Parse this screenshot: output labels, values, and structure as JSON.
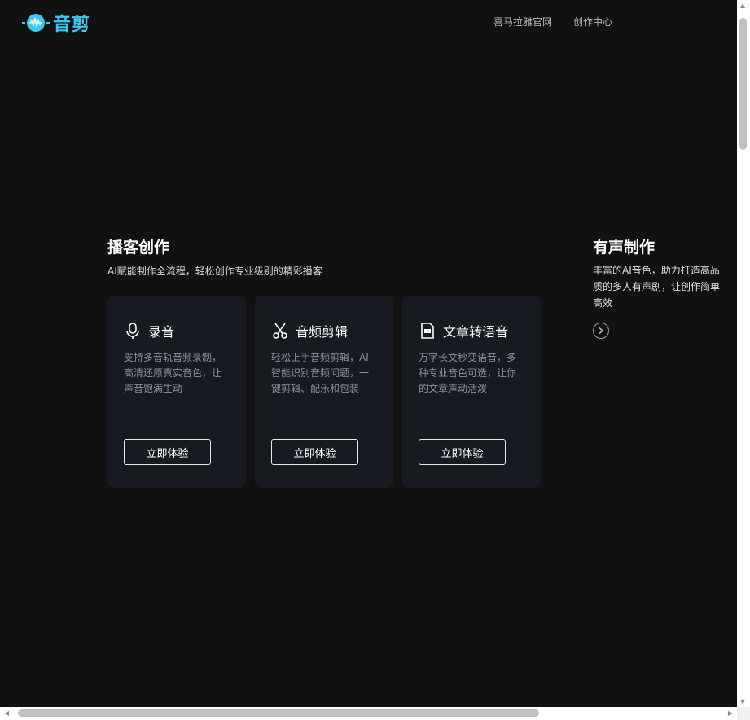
{
  "header": {
    "logo_text": "音剪",
    "nav": [
      "喜马拉雅官网",
      "创作中心"
    ]
  },
  "podcast": {
    "title": "播客创作",
    "subtitle": "AI赋能制作全流程，轻松创作专业级别的精彩播客",
    "cards": [
      {
        "icon": "microphone-icon",
        "title": "录音",
        "desc": "支持多音轨音频录制，高清还原真实音色，让声音饱满生动",
        "button": "立即体验"
      },
      {
        "icon": "scissors-icon",
        "title": "音频剪辑",
        "desc": "轻松上手音频剪辑，AI智能识别音频问题，一键剪辑、配乐和包装",
        "button": "立即体验"
      },
      {
        "icon": "text-file-icon",
        "title": "文章转语音",
        "desc": "万字长文秒变语音，多种专业音色可选，让你的文章声动活泼",
        "button": "立即体验"
      }
    ]
  },
  "audio_production": {
    "title": "有声制作",
    "desc": "丰富的AI音色，助力打造高品质的多人有声剧，让创作简单高效"
  },
  "colors": {
    "background": "#121112",
    "card": "#171a21",
    "logo_accent": "#3fc8f2"
  }
}
